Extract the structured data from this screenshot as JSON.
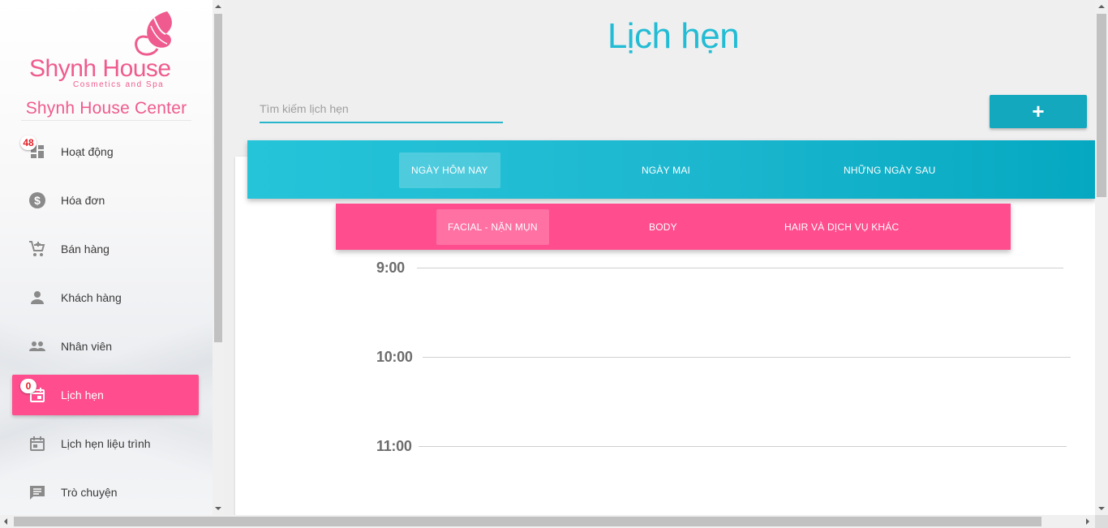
{
  "brand": {
    "logo_text": "Shynh House",
    "logo_sub": "Cosmetics and Spa",
    "center_name": "Shynh House Center"
  },
  "sidebar": {
    "items": [
      {
        "label": "Hoạt động",
        "icon": "dashboard-icon",
        "badge": "48",
        "active": false
      },
      {
        "label": "Hóa đơn",
        "icon": "dollar-circle-icon",
        "badge": null,
        "active": false
      },
      {
        "label": "Bán hàng",
        "icon": "add-cart-icon",
        "badge": null,
        "active": false
      },
      {
        "label": "Khách hàng",
        "icon": "person-icon",
        "badge": null,
        "active": false
      },
      {
        "label": "Nhân viên",
        "icon": "people-icon",
        "badge": null,
        "active": false
      },
      {
        "label": "Lịch hẹn",
        "icon": "calendar-check-icon",
        "badge": "0",
        "active": true
      },
      {
        "label": "Lịch hẹn liệu trình",
        "icon": "calendar-icon",
        "badge": null,
        "active": false
      },
      {
        "label": "Trò chuyện",
        "icon": "chat-icon",
        "badge": null,
        "active": false
      }
    ]
  },
  "main": {
    "title": "Lịch hẹn",
    "search_placeholder": "Tìm kiếm lịch hẹn",
    "add_button_label": "+",
    "day_tabs": [
      {
        "label": "NGÀY HÔM NAY",
        "active": true
      },
      {
        "label": "NGÀY MAI",
        "active": false
      },
      {
        "label": "NHỮNG NGÀY SAU",
        "active": false
      }
    ],
    "service_tabs": [
      {
        "label": "FACIAL - NẶN MỤN",
        "active": true
      },
      {
        "label": "BODY",
        "active": false
      },
      {
        "label": "HAIR VÀ DỊCH VỤ KHÁC",
        "active": false
      }
    ],
    "time_slots": [
      "9:00",
      "10:00",
      "11:00"
    ]
  },
  "colors": {
    "brand_pink": "#ff4d8d",
    "brand_teal": "#22bcd4",
    "add_button": "#13a8be"
  }
}
